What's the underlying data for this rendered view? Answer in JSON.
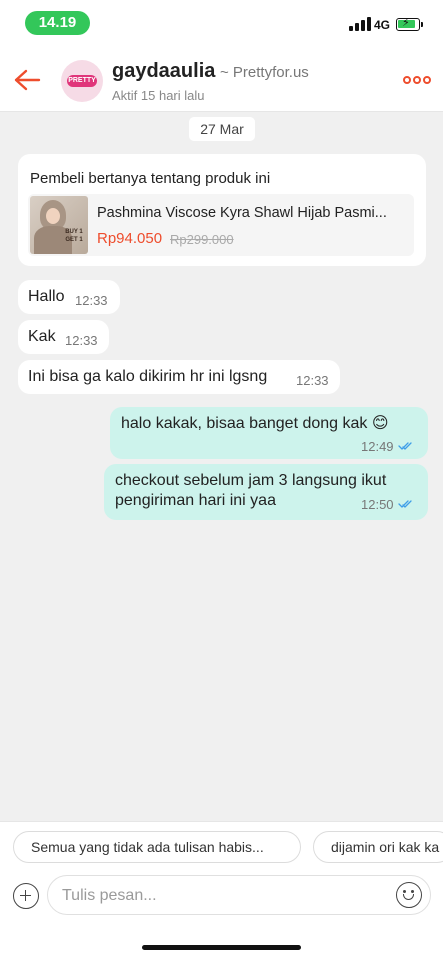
{
  "status_bar": {
    "time": "14.19",
    "network": "4G",
    "battery_charging": true
  },
  "header": {
    "username": "gaydaaulia",
    "shop": "~ Prettyfor.us",
    "status": "Aktif 15 hari lalu",
    "avatar_logo": "PRETTY",
    "accent_color": "#ee4d2d"
  },
  "chat": {
    "date": "27 Mar",
    "product_card": {
      "caption": "Pembeli bertanya tentang produk ini",
      "title": "Pashmina Viscose Kyra Shawl Hijab Pasmi...",
      "price": "Rp94.050",
      "original_price": "Rp299.000",
      "thumb_promo": "BUY 1 GET 1"
    },
    "incoming": [
      {
        "text": "Hallo",
        "time": "12:33"
      },
      {
        "text": "Kak",
        "time": "12:33"
      },
      {
        "text": "Ini bisa ga kalo dikirim hr ini lgsng",
        "time": "12:33"
      }
    ],
    "outgoing": [
      {
        "text": "halo kakak, bisaa banget dong kak 😊",
        "time": "12:49",
        "read": true
      },
      {
        "line1": "checkout sebelum jam 3 langsung ikut",
        "line2": "pengiriman hari ini yaa",
        "time": "12:50",
        "read": true
      }
    ]
  },
  "quick_replies": [
    {
      "label": "Semua yang tidak ada tulisan habis..."
    },
    {
      "label": "dijamin ori kak ka"
    }
  ],
  "composer": {
    "placeholder": "Tulis pesan...",
    "value": ""
  }
}
